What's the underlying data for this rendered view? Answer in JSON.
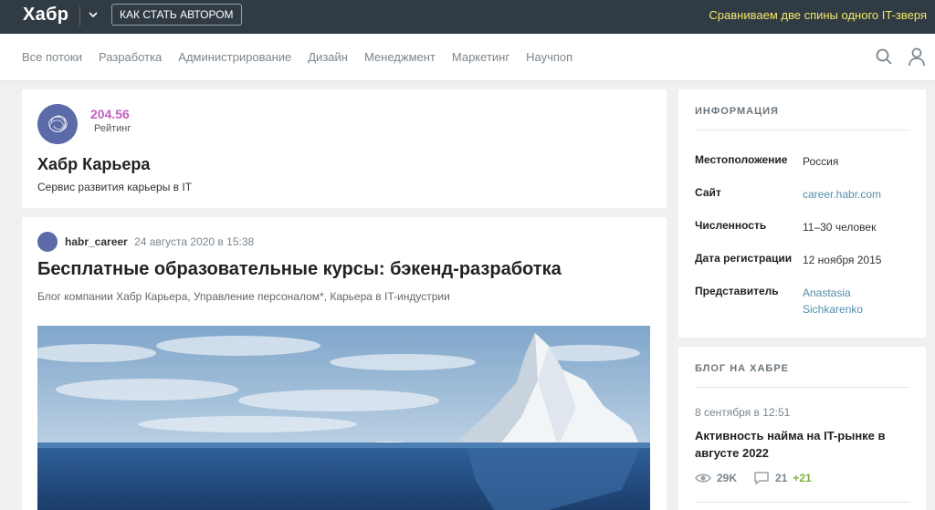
{
  "header": {
    "logo": "Хабр",
    "author_button": "Как стать автором",
    "promo": "Сравниваем две спины одного IT-зверя"
  },
  "nav": {
    "items": [
      "Все потоки",
      "Разработка",
      "Администрирование",
      "Дизайн",
      "Менеджмент",
      "Маркетинг",
      "Научпоп"
    ]
  },
  "company": {
    "rating_value": "204.56",
    "rating_label": "Рейтинг",
    "name": "Хабр Карьера",
    "description": "Сервис развития карьеры в IT"
  },
  "post": {
    "author": "habr_career",
    "date": "24 августа 2020 в 15:38",
    "title": "Бесплатные образовательные курсы: бэкенд-разработка",
    "hubs": "Блог компании Хабр Карьера, Управление персоналом*, Карьера в IT-индустрии"
  },
  "info": {
    "heading": "Информация",
    "rows": [
      {
        "key": "Местоположение",
        "value": "Россия"
      },
      {
        "key": "Сайт",
        "value": "career.habr.com"
      },
      {
        "key": "Численность",
        "value": "11–30 человек"
      },
      {
        "key": "Дата регистрации",
        "value": "12 ноября 2015"
      },
      {
        "key": "Представитель",
        "value": "Anastasia Sichkarenko"
      }
    ]
  },
  "blog": {
    "heading": "Блог на Хабре",
    "date": "8 сентября в 12:51",
    "title": "Активность найма на IT-рынке в августе 2022",
    "views": "29K",
    "comments": "21",
    "comments_new": "+21"
  },
  "colors": {
    "topbar": "#303b44",
    "promo": "#f4e86a",
    "rating": "#c55fbf",
    "link": "#548eaa",
    "positive": "#7db039"
  },
  "icons": [
    "chevron-down-icon",
    "search-icon",
    "user-icon",
    "views-icon",
    "comments-icon"
  ]
}
